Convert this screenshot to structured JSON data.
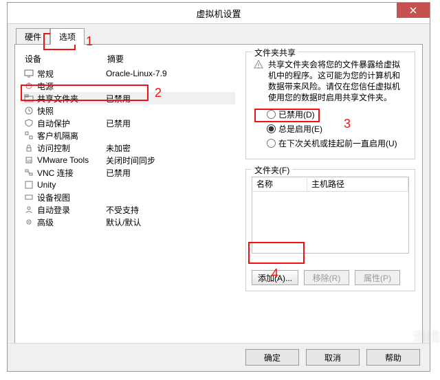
{
  "window": {
    "title": "虚拟机设置",
    "close_icon": "close"
  },
  "tabs": {
    "hardware": "硬件",
    "options": "选项"
  },
  "list": {
    "header_device": "设备",
    "header_summary": "摘要",
    "rows": [
      {
        "id": "general",
        "label": "常规",
        "summary": "Oracle-Linux-7.9"
      },
      {
        "id": "power",
        "label": "电源",
        "summary": ""
      },
      {
        "id": "shared",
        "label": "共享文件夹",
        "summary": "已禁用"
      },
      {
        "id": "snapshot",
        "label": "快照",
        "summary": ""
      },
      {
        "id": "autoprot",
        "label": "自动保护",
        "summary": "已禁用"
      },
      {
        "id": "guestiso",
        "label": "客户机隔离",
        "summary": ""
      },
      {
        "id": "access",
        "label": "访问控制",
        "summary": "未加密"
      },
      {
        "id": "vmtools",
        "label": "VMware Tools",
        "summary": "关闭时间同步"
      },
      {
        "id": "vnc",
        "label": "VNC 连接",
        "summary": "已禁用"
      },
      {
        "id": "unity",
        "label": "Unity",
        "summary": ""
      },
      {
        "id": "devview",
        "label": "设备视图",
        "summary": ""
      },
      {
        "id": "autologin",
        "label": "自动登录",
        "summary": "不受支持"
      },
      {
        "id": "advanced",
        "label": "高级",
        "summary": "默认/默认"
      }
    ]
  },
  "share": {
    "group_title": "文件夹共享",
    "warning": "共享文件夹会将您的文件暴露给虚拟机中的程序。这可能为您的计算机和数据带来风险。请仅在您信任虚拟机使用您的数据时启用共享文件夹。",
    "radio_disabled": "已禁用(D)",
    "radio_always": "总是启用(E)",
    "radio_nextoff": "在下次关机或挂起前一直启用(U)"
  },
  "folders": {
    "group_title": "文件夹(F)",
    "col_name": "名称",
    "col_path": "主机路径",
    "btn_add": "添加(A)...",
    "btn_remove": "移除(R)",
    "btn_prop": "属性(P)"
  },
  "footer": {
    "ok": "确定",
    "cancel": "取消",
    "help": "帮助"
  },
  "callouts": {
    "n1": "1",
    "n2": "2",
    "n3": "3",
    "n4": "4"
  },
  "watermark": "滑稽"
}
